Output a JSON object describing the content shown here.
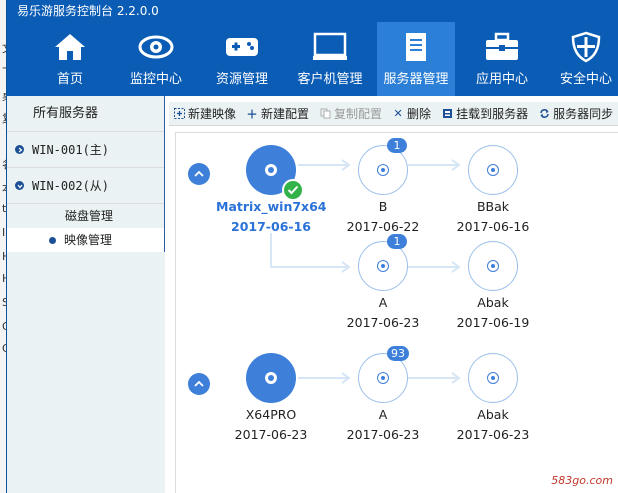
{
  "window": {
    "title": "易乐游服务控制台 2.2.0.0"
  },
  "background_window": {
    "fragments": [
      "文",
      "下",
      "桌",
      "复",
      "名",
      "本",
      "to",
      "IN",
      "H",
      "H",
      "S",
      "G",
      "G"
    ]
  },
  "nav": {
    "items": [
      {
        "label": "首页",
        "icon": "home-icon"
      },
      {
        "label": "监控中心",
        "icon": "eye-icon"
      },
      {
        "label": "资源管理",
        "icon": "gamepad-icon"
      },
      {
        "label": "客户机管理",
        "icon": "monitor-icon"
      },
      {
        "label": "服务器管理",
        "icon": "document-icon",
        "active": true
      },
      {
        "label": "应用中心",
        "icon": "toolbox-icon"
      },
      {
        "label": "安全中心",
        "icon": "shield-icon"
      }
    ]
  },
  "sidebar": {
    "header": "所有服务器",
    "servers": [
      {
        "label": "WIN-001(主)"
      },
      {
        "label": "WIN-002(从)"
      }
    ],
    "subitems": [
      {
        "label": "磁盘管理"
      },
      {
        "label": "映像管理",
        "selected": true
      }
    ]
  },
  "toolbar": {
    "new_image": "新建映像",
    "new_config": "新建配置",
    "copy_config": "复制配置",
    "delete": "删除",
    "mount": "挂载到服务器",
    "sync": "服务器同步"
  },
  "tree": {
    "group1": {
      "root": {
        "name": "Matrix_win7x64",
        "date": "2017-06-16",
        "selected": true
      },
      "row1": [
        {
          "name": "B",
          "date": "2017-06-22",
          "badge": "1"
        },
        {
          "name": "BBak",
          "date": "2017-06-16"
        }
      ],
      "row2": [
        {
          "name": "A",
          "date": "2017-06-23",
          "badge": "1"
        },
        {
          "name": "Abak",
          "date": "2017-06-19"
        }
      ]
    },
    "group2": {
      "root": {
        "name": "X64PRO",
        "date": "2017-06-23"
      },
      "row1": [
        {
          "name": "A",
          "date": "2017-06-23",
          "badge": "93"
        },
        {
          "name": "Abak",
          "date": "2017-06-23"
        }
      ]
    }
  },
  "watermark": "583go.com",
  "colors": {
    "titlebar": "#0b5cb5",
    "nav_active": "#2b7fd6",
    "accent": "#3d7fd9",
    "check": "#33b24a"
  }
}
